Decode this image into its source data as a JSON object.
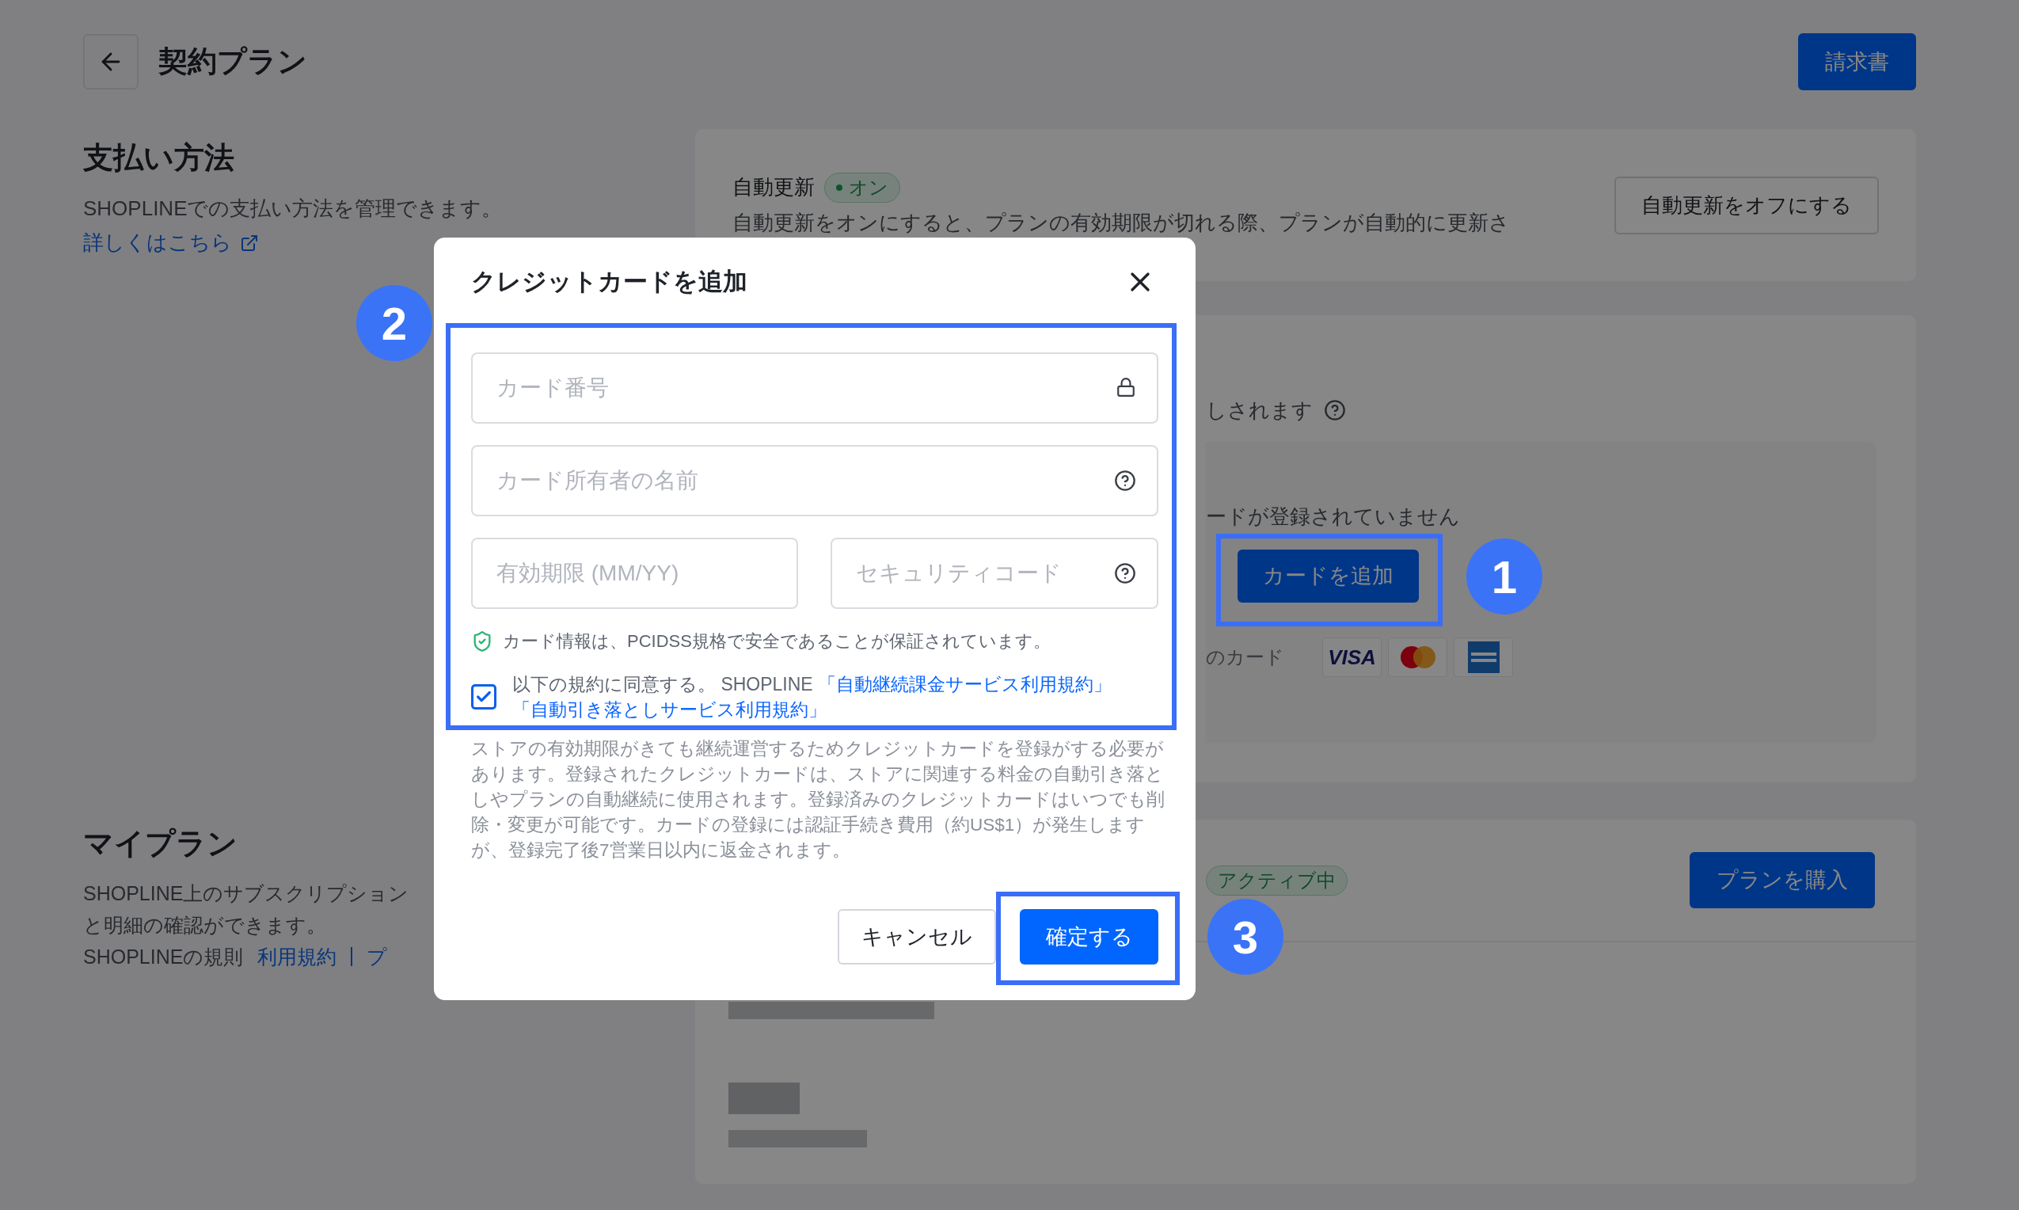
{
  "header": {
    "title": "契約プラン",
    "invoice_button": "請求書"
  },
  "payment_section": {
    "heading": "支払い方法",
    "description": "SHOPLINEでの支払い方法を管理できます。",
    "link": "詳しくはこちら"
  },
  "auto_renew": {
    "label": "自動更新",
    "status": {
      "text": "オン",
      "on": true
    },
    "description": "自動更新をオンにすると、プランの有効期限が切れる際、プランが自動的に更新さ",
    "button": "自動更新をオフにする"
  },
  "payment_card": {
    "note": "しされます",
    "empty_text": "ードが登録されていません",
    "add_button": "カードを追加",
    "accepted_label": "のカード",
    "brands": [
      {
        "kind": "visa",
        "label": "VISA"
      },
      {
        "kind": "mastercard"
      },
      {
        "kind": "amex"
      }
    ]
  },
  "plan_section": {
    "heading": "マイプラン",
    "description_lines": [
      "SHOPLINE上のサブスクリプション",
      "と明細の確認ができます。"
    ],
    "rules_label": "SHOPLINEの規則",
    "rules_links": [
      "利用規約",
      "プ"
    ]
  },
  "plan_card": {
    "badge": "アクティブ中",
    "button": "プランを購入"
  },
  "dialog": {
    "title": "クレジットカードを追加",
    "fields": [
      {
        "placeholder": "カード番号"
      },
      {
        "placeholder": "カード所有者の名前"
      },
      {
        "placeholder": "有効期限 (MM/YY)"
      },
      {
        "placeholder": "セキュリティコード"
      }
    ],
    "security_note": "カード情報は、PCIDSS規格で安全であることが保証されています。",
    "agreement": {
      "checked": true,
      "text": "以下の規約に同意する。 SHOPLINE",
      "links": [
        "「自動継続課金サービス利用規約」",
        "「自動引き落としサービス利用規約」"
      ]
    },
    "notice": "ストアの有効期限がきても継続運営するためクレジットカードを登録がする必要があります。登録されたクレジットカードは、ストアに関連する料金の自動引き落としやプランの自動継続に使用されます。登録済みのクレジットカードはいつでも削除・変更が可能です。カードの登録には認証手続き費用（約US$1）が発生しますが、登録完了後7営業日以内に返金されます。",
    "cancel_button": "キャンセル",
    "confirm_button": "確定する"
  },
  "annotations": [
    {
      "label": "1"
    },
    {
      "label": "2"
    },
    {
      "label": "3"
    }
  ]
}
